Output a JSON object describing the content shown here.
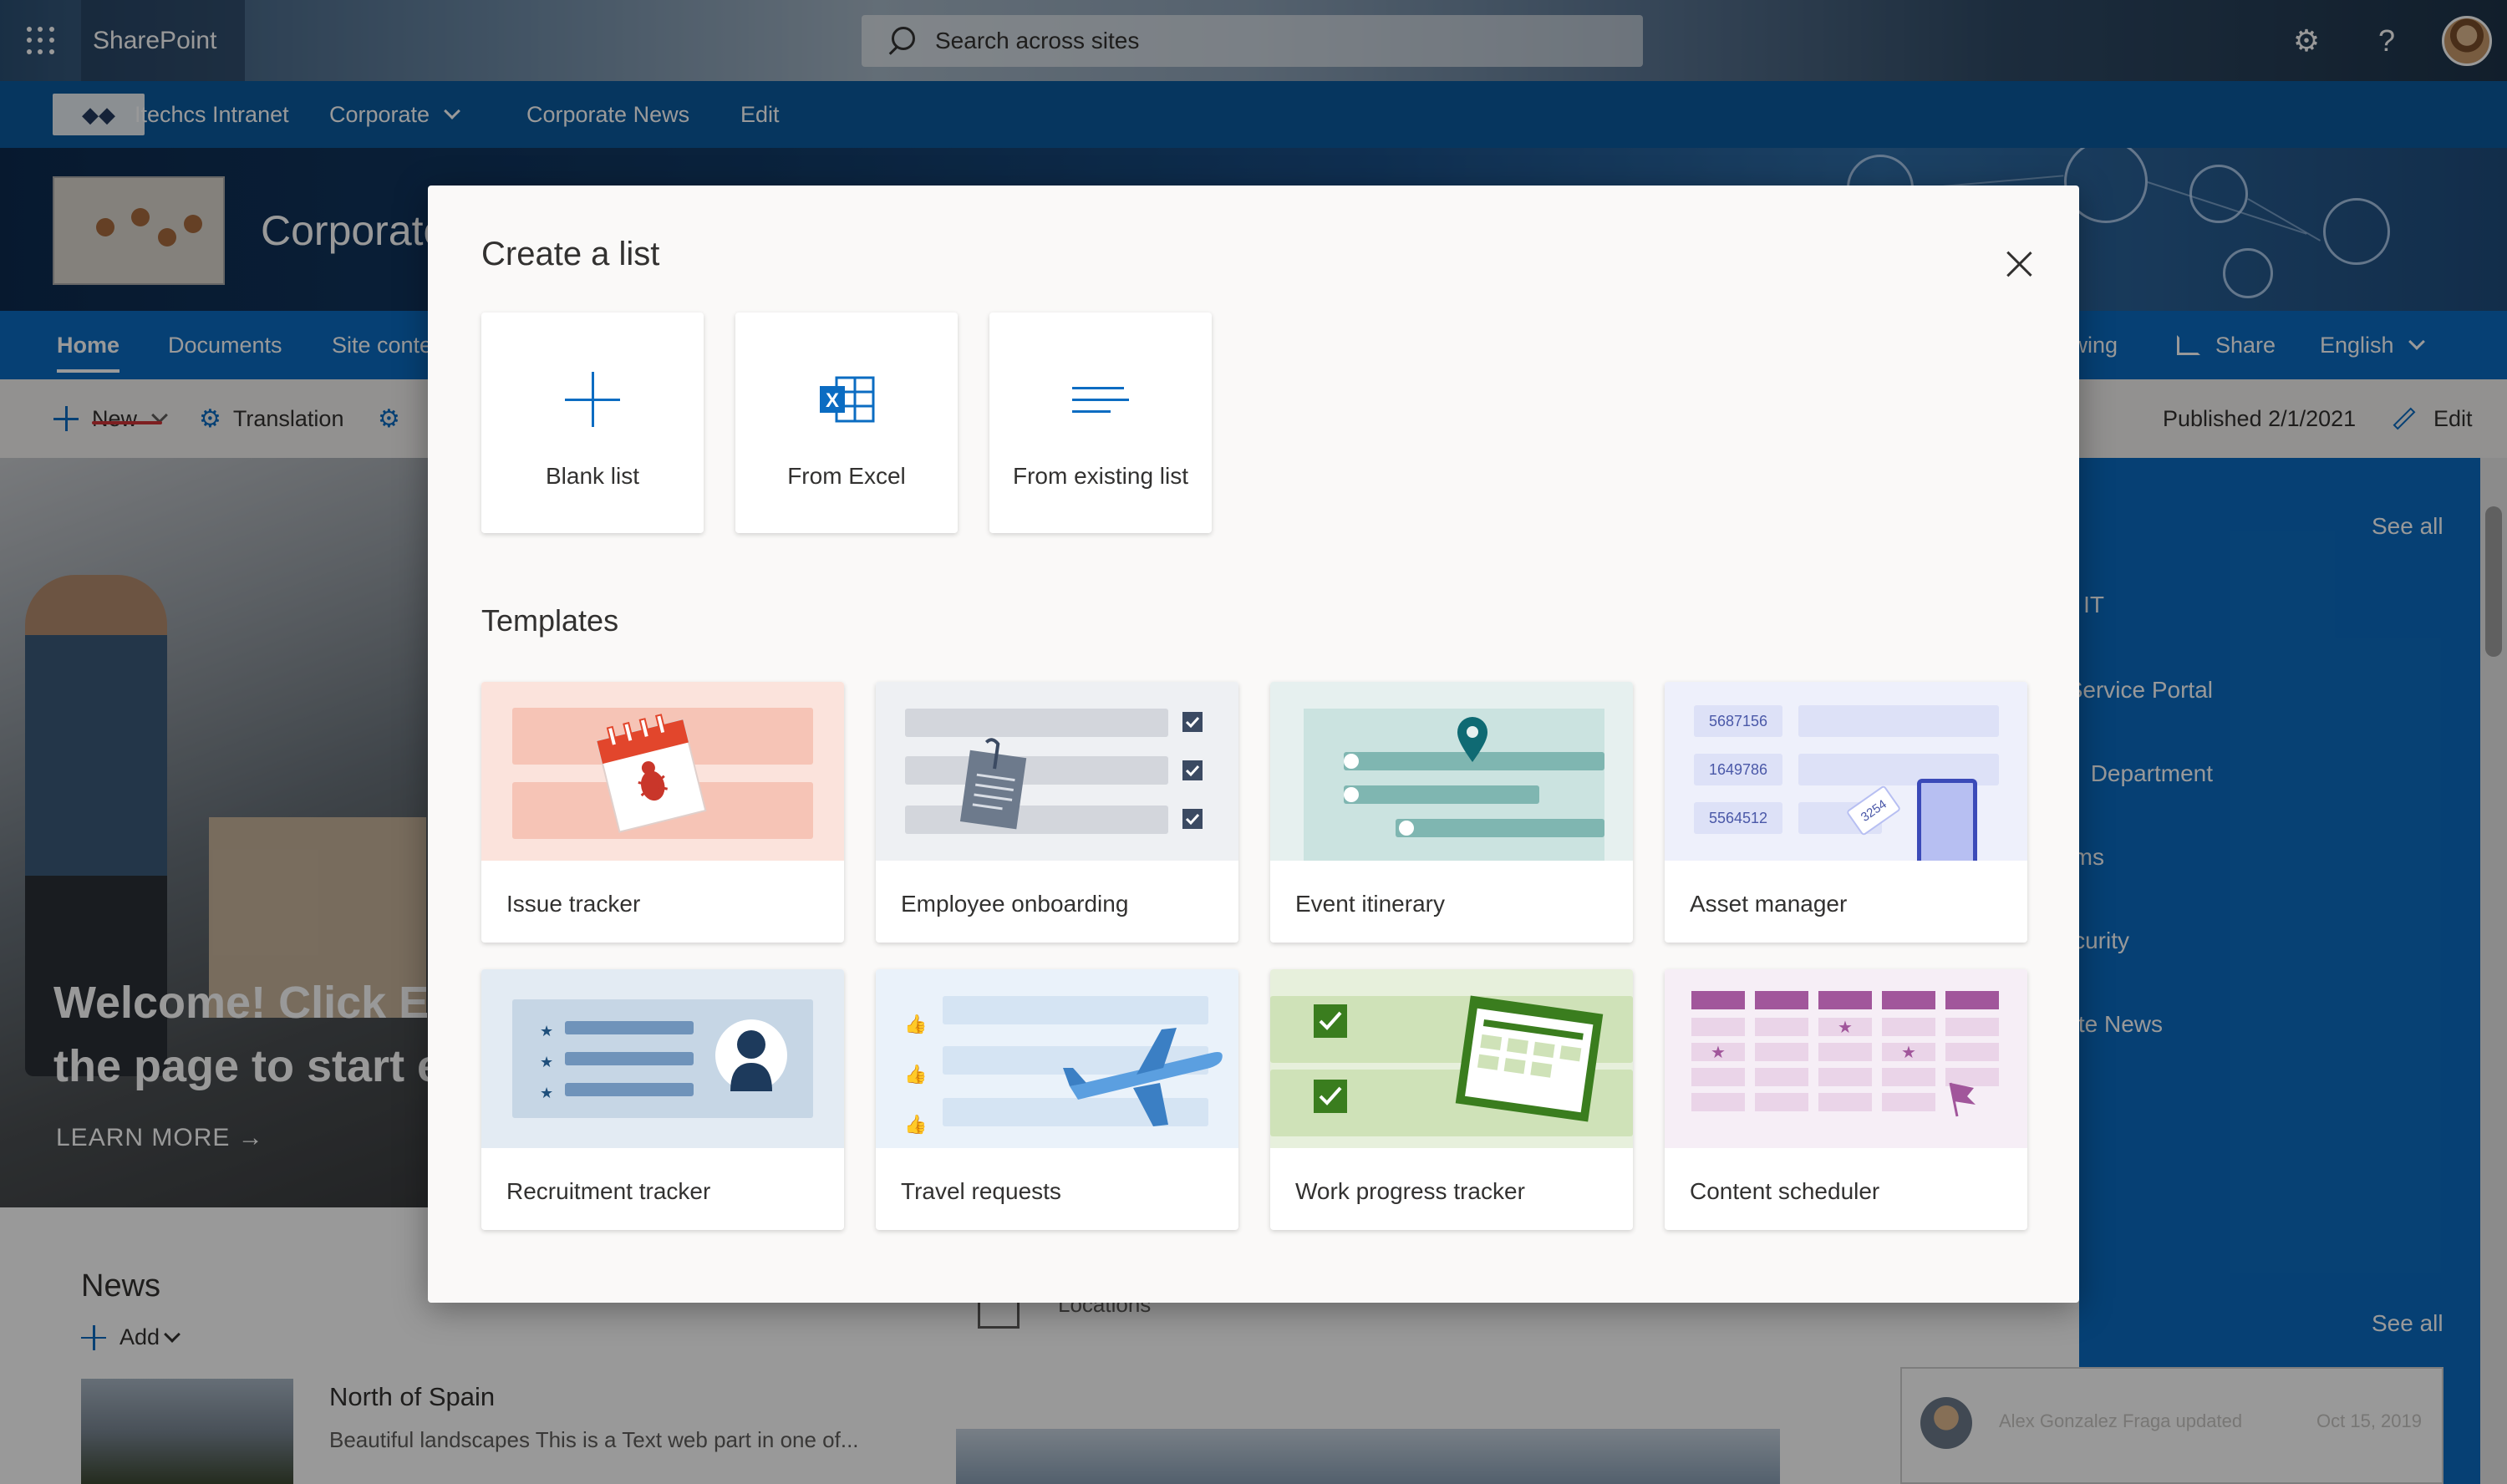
{
  "suite": {
    "brand": "SharePoint",
    "search_placeholder": "Search across sites"
  },
  "hub_nav": {
    "site_name": "Itechcs Intranet",
    "items": [
      "Corporate",
      "Corporate News",
      "Edit"
    ]
  },
  "site": {
    "title": "Corporate"
  },
  "site_nav": {
    "items": [
      "Home",
      "Documents",
      "Site contents"
    ],
    "following": "Following",
    "share": "Share",
    "language": "English"
  },
  "command_bar": {
    "new": "New",
    "translation": "Translation",
    "published": "Published 2/1/2021",
    "edit": "Edit"
  },
  "page": {
    "hero_line1": "Welcome! Click Edit on",
    "hero_line2": "the page to start editing",
    "learn_more": "LEARN MORE →",
    "news_title": "News",
    "add": "Add",
    "news_headline": "North of Spain",
    "news_desc": "Beautiful landscapes This is a Text web part in one of...",
    "locations": "Locations",
    "see_all": "See all",
    "right_links": [
      "IT",
      "Service Portal",
      "Department",
      "Teams",
      "Security",
      "Corporate News"
    ],
    "activity_user": "Alex Gonzalez Fraga updated",
    "activity_date": "Oct 15, 2019"
  },
  "dialog": {
    "title": "Create a list",
    "options": [
      {
        "label": "Blank list",
        "icon": "plus-icon"
      },
      {
        "label": "From Excel",
        "icon": "excel-icon"
      },
      {
        "label": "From existing list",
        "icon": "list-lines-icon"
      }
    ],
    "templates_heading": "Templates",
    "templates": [
      {
        "label": "Issue tracker"
      },
      {
        "label": "Employee onboarding"
      },
      {
        "label": "Event itinerary"
      },
      {
        "label": "Asset manager",
        "art_numbers": [
          "5687156",
          "1649786",
          "5564512"
        ],
        "tag": "3254"
      },
      {
        "label": "Recruitment tracker"
      },
      {
        "label": "Travel requests"
      },
      {
        "label": "Work progress tracker"
      },
      {
        "label": "Content scheduler"
      }
    ]
  },
  "colors": {
    "sharepoint_blue": "#0b6cc2",
    "hub_blue": "#0b5a9e",
    "new_underline": "#d13438"
  }
}
